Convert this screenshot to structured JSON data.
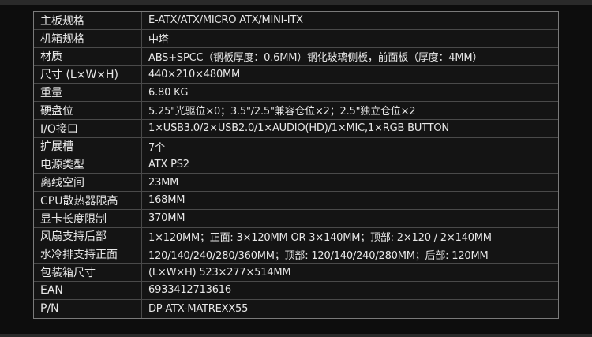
{
  "specs": [
    {
      "label": "主板规格",
      "value": "E-ATX/ATX/MICRO ATX/MINI-ITX"
    },
    {
      "label": "机箱规格",
      "value": "中塔"
    },
    {
      "label": "材质",
      "value": "ABS+SPCC（钢板厚度：0.6MM）钢化玻璃侧板，前面板（厚度：4MM）"
    },
    {
      "label": "尺寸 (L×W×H)",
      "value": "440×210×480MM"
    },
    {
      "label": "重量",
      "value": "6.80 KG"
    },
    {
      "label": "硬盘位",
      "value": "5.25\"光驱位×0；3.5\"/2.5\"兼容仓位×2；2.5\"独立仓位×2"
    },
    {
      "label": "I/O接口",
      "value": "1×USB3.0/2×USB2.0/1×AUDIO(HD)/1×MIC,1×RGB BUTTON"
    },
    {
      "label": "扩展槽",
      "value": "7个"
    },
    {
      "label": "电源类型",
      "value": "ATX PS2"
    },
    {
      "label": "离线空间",
      "value": "23MM"
    },
    {
      "label": "CPU散热器限高",
      "value": "168MM"
    },
    {
      "label": "显卡长度限制",
      "value": "370MM"
    },
    {
      "label": "风扇支持后部",
      "value": "1×120MM；正面: 3×120MM OR 3×140MM；顶部: 2×120 / 2×140MM"
    },
    {
      "label": "水冷排支持正面",
      "value": "120/140/240/280/360MM；顶部: 120/140/240/280MM；后部: 120MM"
    },
    {
      "label": "包装箱尺寸",
      "value": "(L×W×H) 523×277×514MM"
    },
    {
      "label": "EAN",
      "value": "6933412713616"
    },
    {
      "label": "P/N",
      "value": "DP-ATX-MATREXX55"
    }
  ]
}
